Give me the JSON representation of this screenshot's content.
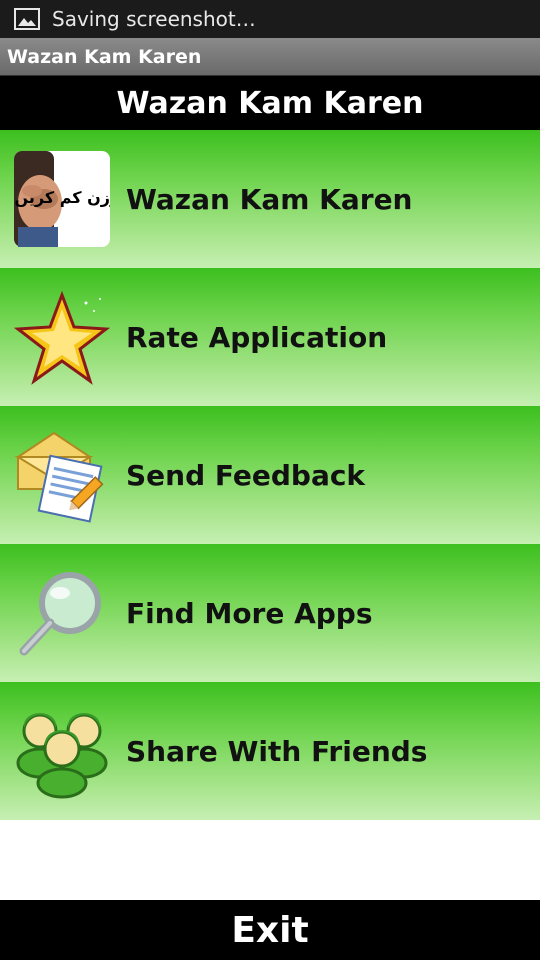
{
  "status_bar": {
    "icon": "image-icon",
    "text": "Saving screenshot…"
  },
  "titlebar": {
    "title": "Wazan Kam Karen"
  },
  "header": {
    "title": "Wazan Kam Karen"
  },
  "menu": {
    "items": [
      {
        "label": "Wazan Kam Karen",
        "icon": "app-logo-icon"
      },
      {
        "label": "Rate Application",
        "icon": "star-icon"
      },
      {
        "label": "Send Feedback",
        "icon": "envelope-pencil-icon"
      },
      {
        "label": "Find More Apps",
        "icon": "magnifier-icon"
      },
      {
        "label": "Share With Friends",
        "icon": "people-icon"
      }
    ]
  },
  "app_logo": {
    "urdu_text": "اپنا وزن کم کریں"
  },
  "exit": {
    "label": "Exit"
  },
  "colors": {
    "menu_top": "#3cbf1e",
    "menu_bottom": "#c6efb3",
    "header_bg": "#000000",
    "status_bg": "#1b1b1b"
  }
}
